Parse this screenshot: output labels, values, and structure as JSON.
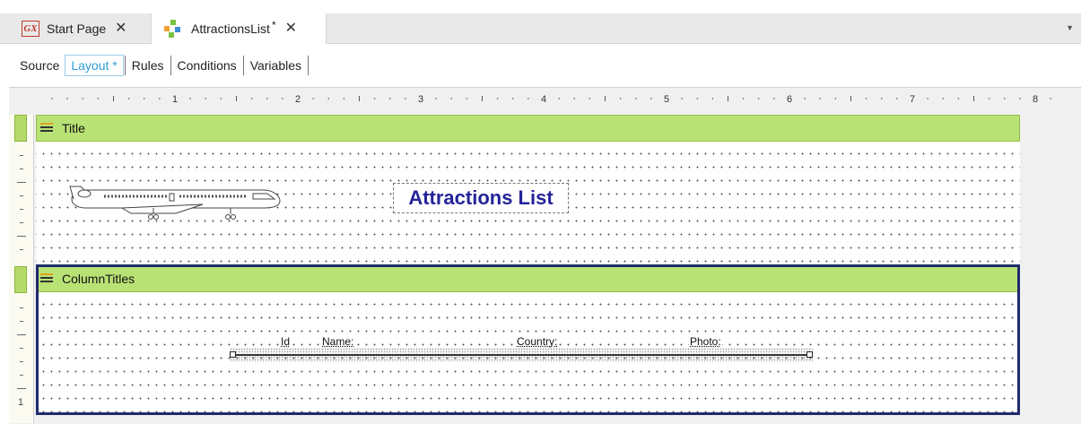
{
  "tabs": [
    {
      "icon": "gx-icon",
      "icon_text": "GX",
      "label": "Start Page",
      "dirty": false
    },
    {
      "icon": "procedure-icon",
      "label": "AttractionsList",
      "dirty": true,
      "dirty_mark": "*"
    }
  ],
  "close_glyph": "✕",
  "subtabs": [
    "Source",
    "Layout *",
    "Rules",
    "Conditions",
    "Variables"
  ],
  "ruler": {
    "corner_glyph": "↘",
    "h_numbers": [
      "1",
      "2",
      "3",
      "4",
      "5",
      "6",
      "7",
      "8"
    ],
    "v_numbers": [
      "1"
    ]
  },
  "bands": [
    {
      "name": "Title"
    },
    {
      "name": "ColumnTitles"
    }
  ],
  "title_band": {
    "heading": "Attractions List",
    "image": "airplane-image"
  },
  "column_titles": [
    "Id",
    "Name:",
    "Country:",
    "Photo:"
  ],
  "colors": {
    "band_header": "#b9e275",
    "selection_border": "#1f2b6b",
    "heading_text": "#24249a",
    "active_subtab": "#2f9fd8"
  }
}
